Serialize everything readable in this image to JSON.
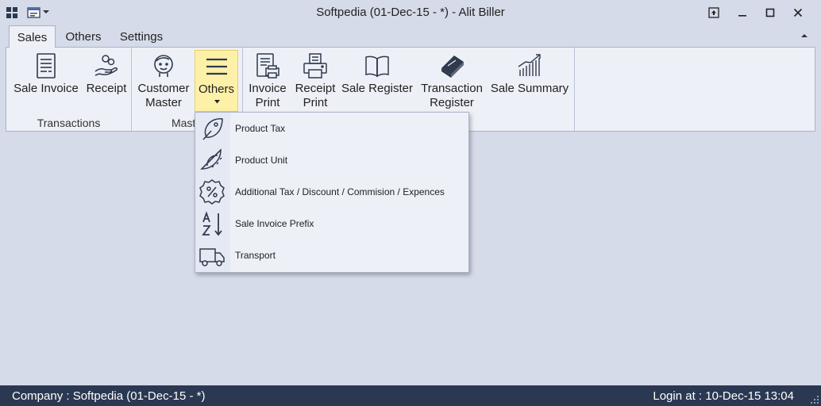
{
  "window": {
    "title": "Softpedia (01-Dec-15 - *) - Alit Biller"
  },
  "tabs": [
    {
      "label": "Sales",
      "active": true
    },
    {
      "label": "Others",
      "active": false
    },
    {
      "label": "Settings",
      "active": false
    }
  ],
  "ribbon": {
    "groups": [
      {
        "label": "Transactions"
      },
      {
        "label": "Maste"
      },
      {
        "label": ""
      }
    ],
    "buttons": {
      "sale_invoice": {
        "label": "Sale Invoice",
        "icon": "invoice-icon"
      },
      "receipt": {
        "label": "Receipt",
        "icon": "receipt-hand-icon"
      },
      "customer_master": {
        "line1": "Customer",
        "line2": "Master",
        "icon": "customer-face-icon"
      },
      "others": {
        "label": "Others",
        "icon": "hamburger-menu-icon"
      },
      "invoice_print": {
        "line1": "Invoice",
        "line2": "Print",
        "icon": "invoice-print-icon"
      },
      "receipt_print": {
        "line1": "Receipt",
        "line2": "Print",
        "icon": "receipt-print-icon"
      },
      "sale_register": {
        "label": "Sale Register",
        "icon": "open-book-icon"
      },
      "transaction_register": {
        "line1": "Transaction",
        "line2": "Register",
        "icon": "closed-book-icon"
      },
      "sale_summary": {
        "label": "Sale Summary",
        "icon": "growth-chart-icon"
      }
    }
  },
  "dropdown": {
    "items": [
      {
        "label": "Product Tax",
        "icon": "leaf-tag-icon"
      },
      {
        "label": "Product Unit",
        "icon": "protractor-icon"
      },
      {
        "label": "Additional Tax / Discount / Commision / Expences",
        "icon": "percent-badge-icon"
      },
      {
        "label": "Sale Invoice Prefix",
        "icon": "sort-az-icon"
      },
      {
        "label": "Transport",
        "icon": "truck-icon"
      }
    ]
  },
  "statusbar": {
    "company": "Company : Softpedia  (01-Dec-15 - *)",
    "login": "Login at : 10-Dec-15 13:04"
  },
  "colors": {
    "background": "#d6dbe9",
    "ribbon": "#eef0f7",
    "highlight": "#fdf1a8",
    "statusbar": "#2b3852",
    "icon": "#2f3a4d"
  }
}
